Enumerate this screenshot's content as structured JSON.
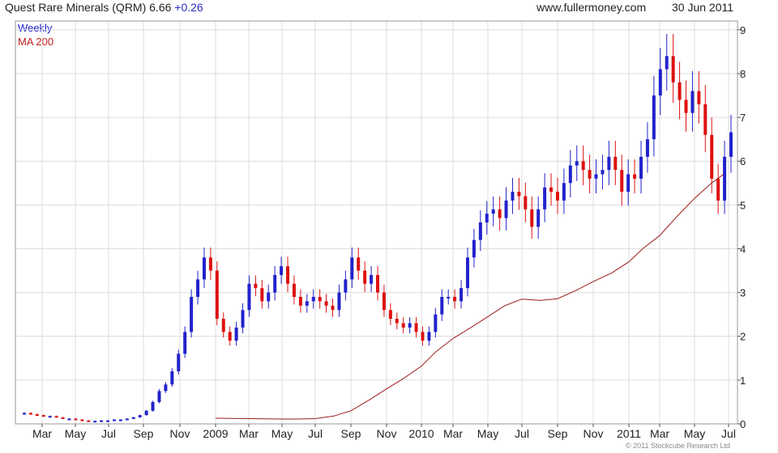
{
  "header": {
    "title": "Quest Rare Minerals (QRM) 6.66",
    "change": "+0.26",
    "site": "www.fullermoney.com",
    "date": "30 Jun 2011"
  },
  "copyright": "© 2011 Stockcube Research Ltd",
  "colors": {
    "up": "#2222cc",
    "down": "#dd1111",
    "ma": "#9b1a1a",
    "grid": "#dcdcdc"
  },
  "chart_data": {
    "type": "candlestick",
    "title": "Quest Rare Minerals (QRM)",
    "legend": [
      "Weekly",
      "MA 200"
    ],
    "ylim": [
      0,
      9.2
    ],
    "y_ticks": [
      0,
      1,
      2,
      3,
      4,
      5,
      6,
      7,
      8,
      9
    ],
    "x_ticks": [
      "Mar",
      "May",
      "Jul",
      "Sep",
      "Nov",
      "2009",
      "Mar",
      "May",
      "Jul",
      "Sep",
      "Nov",
      "2010",
      "Mar",
      "May",
      "Jul",
      "Sep",
      "Nov",
      "2011",
      "Mar",
      "May",
      "Jul"
    ],
    "x_tick_index": [
      0,
      1,
      2,
      3,
      4,
      5,
      6,
      7,
      8,
      9,
      10,
      11,
      12,
      13,
      14,
      15,
      16,
      17,
      18,
      19,
      20
    ],
    "close_sequence": [
      0.25,
      0.22,
      0.2,
      0.18,
      0.18,
      0.15,
      0.12,
      0.12,
      0.1,
      0.08,
      0.07,
      0.07,
      0.08,
      0.08,
      0.1,
      0.1,
      0.12,
      0.15,
      0.2,
      0.3,
      0.5,
      0.75,
      0.9,
      1.2,
      1.6,
      2.1,
      2.9,
      3.3,
      3.8,
      3.5,
      2.4,
      2.1,
      1.9,
      2.2,
      2.6,
      3.2,
      3.1,
      2.8,
      3.0,
      3.4,
      3.6,
      3.2,
      2.9,
      2.7,
      2.8,
      2.9,
      2.8,
      2.7,
      2.6,
      3.0,
      3.3,
      3.8,
      3.5,
      3.2,
      3.4,
      3.0,
      2.6,
      2.4,
      2.3,
      2.2,
      2.3,
      2.1,
      1.9,
      2.1,
      2.5,
      2.9,
      2.9,
      2.8,
      3.1,
      3.8,
      4.2,
      4.6,
      4.8,
      4.9,
      4.7,
      5.1,
      5.3,
      5.2,
      4.9,
      4.5,
      4.9,
      5.4,
      5.3,
      5.1,
      5.5,
      5.9,
      6.0,
      5.8,
      5.6,
      5.7,
      5.8,
      6.1,
      5.8,
      5.3,
      5.7,
      5.6,
      6.1,
      6.5,
      7.5,
      8.1,
      8.4,
      7.8,
      7.4,
      7.1,
      7.6,
      7.3,
      6.6,
      5.6,
      5.1,
      6.1,
      6.66
    ],
    "ma200_points": [
      [
        5,
        0.13
      ],
      [
        6,
        0.12
      ],
      [
        7,
        0.11
      ],
      [
        7.5,
        0.11
      ],
      [
        8,
        0.12
      ],
      [
        8.5,
        0.18
      ],
      [
        9,
        0.3
      ],
      [
        9.5,
        0.55
      ],
      [
        10,
        0.8
      ],
      [
        10.5,
        1.05
      ],
      [
        11,
        1.32
      ],
      [
        11.5,
        1.65
      ],
      [
        12,
        1.95
      ],
      [
        12.5,
        2.2
      ],
      [
        13,
        2.45
      ],
      [
        13.5,
        2.7
      ],
      [
        14,
        2.85
      ],
      [
        14.5,
        2.82
      ],
      [
        15,
        2.86
      ],
      [
        15.5,
        3.05
      ],
      [
        16,
        3.25
      ],
      [
        16.5,
        3.45
      ],
      [
        17,
        3.7
      ],
      [
        17.5,
        4.0
      ],
      [
        18,
        4.3
      ],
      [
        18.5,
        4.75
      ],
      [
        19,
        5.15
      ],
      [
        19.5,
        5.5
      ],
      [
        19.85,
        5.7
      ]
    ]
  }
}
